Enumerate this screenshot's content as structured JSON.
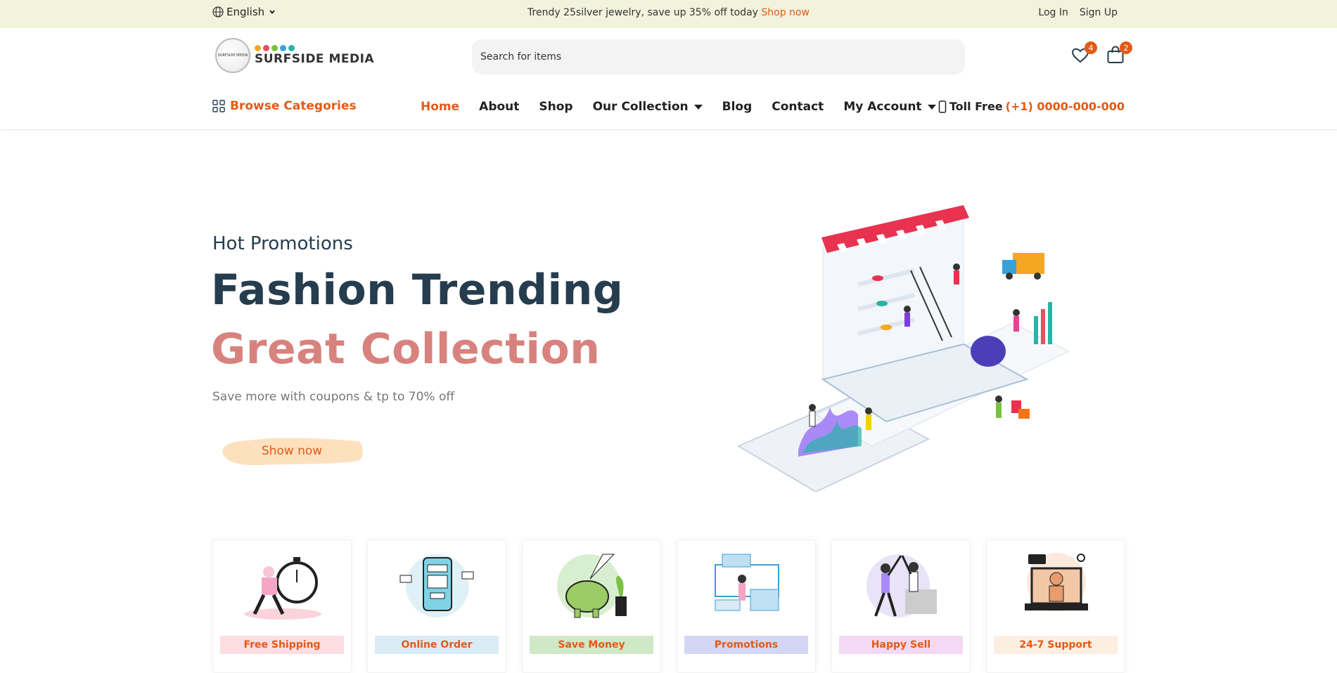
{
  "topbar": {
    "language": "English",
    "promo_text": "Trendy 25silver jewelry, save up 35% off today",
    "promo_link": "Shop now",
    "login": "Log In",
    "signup": "Sign Up"
  },
  "header": {
    "brand": "SURFSIDE MEDIA",
    "logo_mini": "SURFSIDE MEDIA",
    "search_placeholder": "Search for items",
    "wishlist_count": "4",
    "cart_count": "2"
  },
  "nav": {
    "browse": "Browse Categories",
    "items": [
      {
        "label": "Home"
      },
      {
        "label": "About"
      },
      {
        "label": "Shop"
      },
      {
        "label": "Our Collection"
      },
      {
        "label": "Blog"
      },
      {
        "label": "Contact"
      },
      {
        "label": "My Account"
      }
    ],
    "toll_label": "Toll Free",
    "toll_number": "(+1) 0000-000-000"
  },
  "hero": {
    "subtitle": "Hot Promotions",
    "title_line1": "Fashion Trending",
    "title_line2": "Great Collection",
    "description": "Save more with coupons & tp to 70% off",
    "button": "Show now"
  },
  "features": [
    {
      "label": "Free Shipping",
      "bg": "#fcdde2",
      "icon": "delivery-stopwatch-icon"
    },
    {
      "label": "Online Order",
      "bg": "#d9ebf5",
      "icon": "phone-payment-icon"
    },
    {
      "label": "Save Money",
      "bg": "#cfe9c7",
      "icon": "piggy-bank-icon"
    },
    {
      "label": "Promotions",
      "bg": "#d3d6f5",
      "icon": "promotion-shop-icon"
    },
    {
      "label": "Happy Sell",
      "bg": "#f3d9f3",
      "icon": "high-five-icon"
    },
    {
      "label": "24-7 Support",
      "bg": "#fdeee2",
      "icon": "support-laptop-icon"
    }
  ],
  "colors": {
    "accent": "#e35a15",
    "topbar_bg": "#f2f3dc",
    "heading": "#253d4e",
    "hero_highlight": "#d8827e"
  }
}
